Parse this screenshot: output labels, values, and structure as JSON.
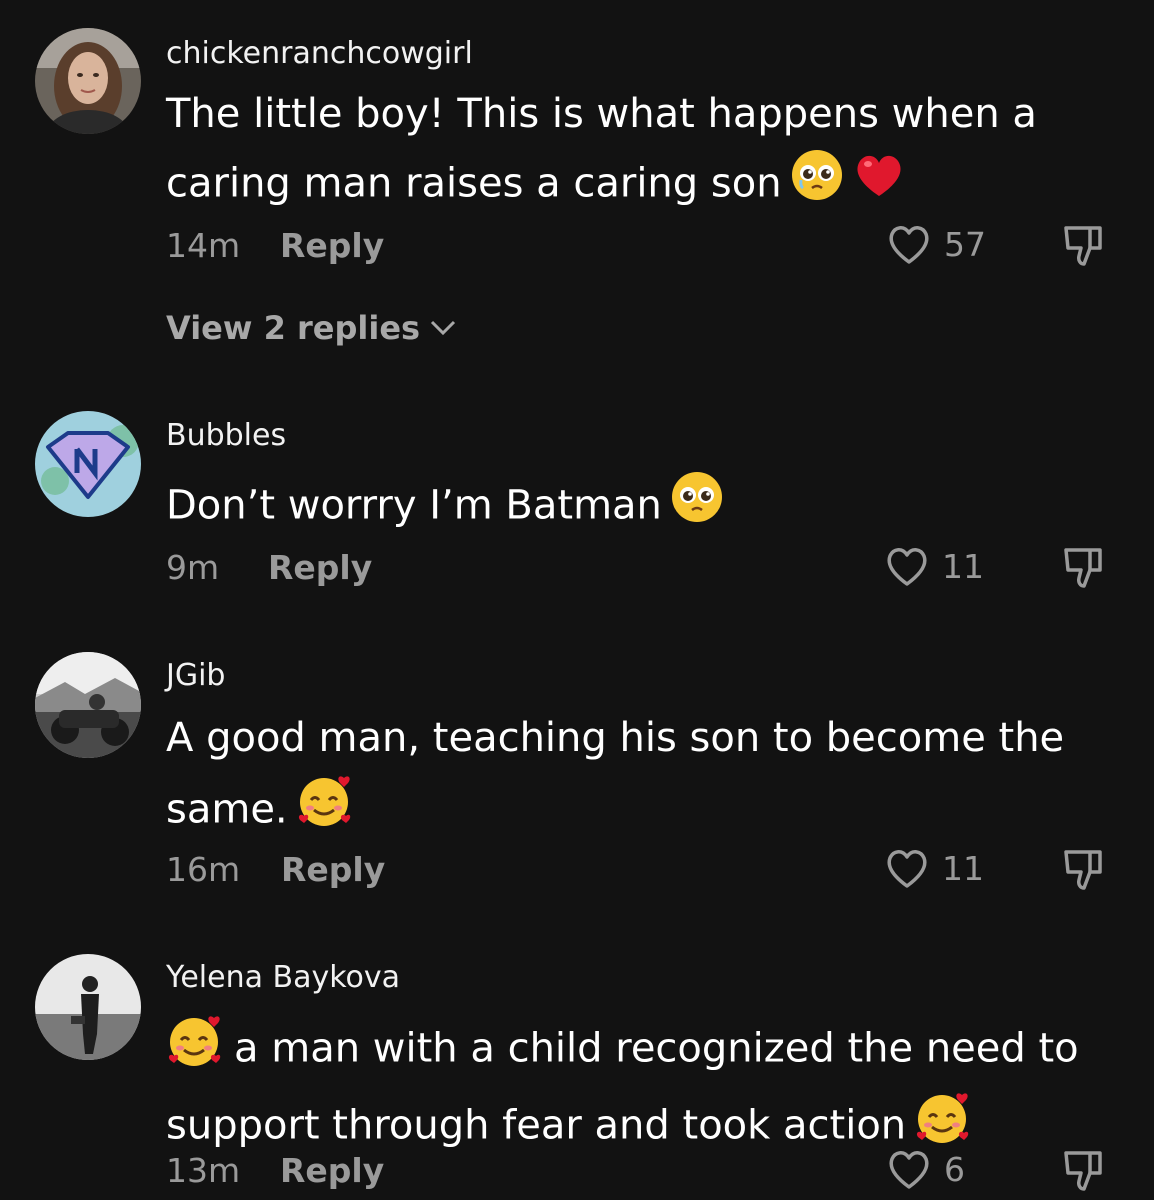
{
  "comments": [
    {
      "username": "chickenranchcowgirl",
      "text": "The little boy! This is what happens when a caring man raises a caring son",
      "emojis": [
        "pleading-face",
        "red-heart"
      ],
      "time": "14m",
      "reply_label": "Reply",
      "likes": "57",
      "view_replies": "View 2 replies"
    },
    {
      "username": "Bubbles",
      "text": "Don’t worrry I’m Batman",
      "emojis": [
        "pleading-face"
      ],
      "time": "9m",
      "reply_label": "Reply",
      "likes": "11"
    },
    {
      "username": "JGib",
      "text": "A good man, teaching his son to become the same.",
      "emojis": [
        "smiling-face-with-hearts"
      ],
      "time": "16m",
      "reply_label": "Reply",
      "likes": "11"
    },
    {
      "username": "Yelena Baykova",
      "text_prefix_emoji": "smiling-face-with-hearts",
      "text": "a man with a child recognized the need to support through fear and took action",
      "emojis": [
        "smiling-face-with-hearts"
      ],
      "time": "13m",
      "reply_label": "Reply",
      "likes": "6"
    }
  ],
  "colors": {
    "background": "#121212",
    "text": "#ffffff",
    "secondary": "#9a9a9a"
  }
}
